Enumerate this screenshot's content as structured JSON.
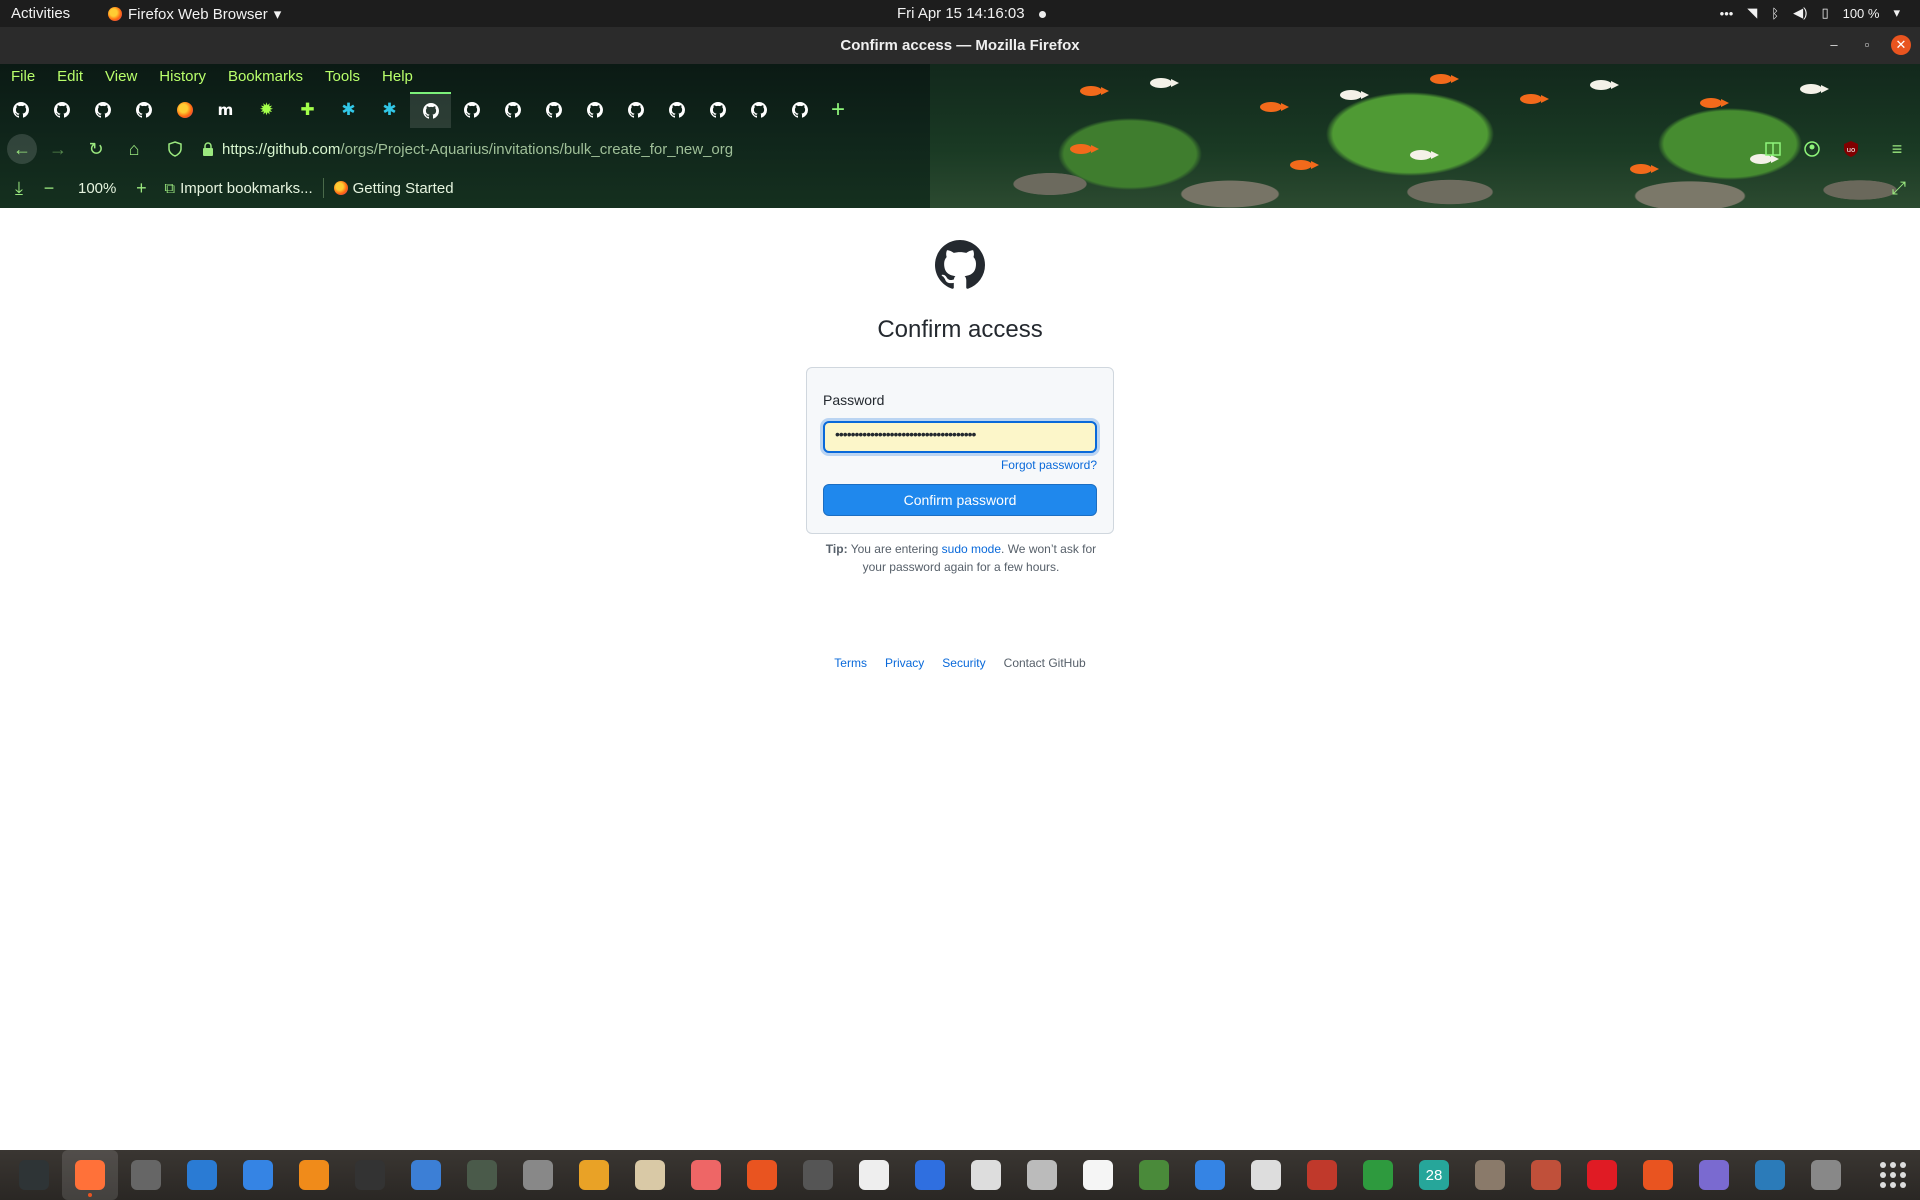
{
  "topbar": {
    "activities": "Activities",
    "app_name": "Firefox Web Browser",
    "clock": "Fri Apr 15  14:16:03",
    "battery": "100 %"
  },
  "window": {
    "title": "Confirm access — Mozilla Firefox"
  },
  "menubar": {
    "items": [
      "File",
      "Edit",
      "View",
      "History",
      "Bookmarks",
      "Tools",
      "Help"
    ]
  },
  "tabs": [
    {
      "icon": "github-icon"
    },
    {
      "icon": "github-icon"
    },
    {
      "icon": "github-icon"
    },
    {
      "icon": "github-icon"
    },
    {
      "icon": "firefox-icon"
    },
    {
      "icon": "m-icon",
      "text": "m"
    },
    {
      "icon": "settings-gear-icon"
    },
    {
      "icon": "puzzle-icon"
    },
    {
      "icon": "snowflake-icon"
    },
    {
      "icon": "snowflake-icon"
    },
    {
      "icon": "github-icon",
      "active": true
    },
    {
      "icon": "github-icon"
    },
    {
      "icon": "github-icon"
    },
    {
      "icon": "github-icon"
    },
    {
      "icon": "github-icon"
    },
    {
      "icon": "github-icon"
    },
    {
      "icon": "github-icon"
    },
    {
      "icon": "github-icon"
    },
    {
      "icon": "github-icon"
    },
    {
      "icon": "github-icon"
    }
  ],
  "url": {
    "host": "https://github.com",
    "path": "/orgs/Project-Aquarius/invitations/bulk_create_for_new_org"
  },
  "bookmarks_bar": {
    "zoom": "100%",
    "import": "Import bookmarks...",
    "getting_started": "Getting Started"
  },
  "page": {
    "title": "Confirm access",
    "password_label": "Password",
    "password_value": "••••••••••••••••••••••••••••••••••••",
    "forgot": "Forgot password?",
    "confirm_button": "Confirm password",
    "tip_label": "Tip:",
    "tip_before": " You are entering ",
    "tip_link": "sudo mode",
    "tip_after": ". We won’t ask for your password again for a few hours.",
    "footer": [
      "Terms",
      "Privacy",
      "Security"
    ],
    "footer_contact": "Contact GitHub"
  },
  "colors": {
    "accent": "#0969da",
    "button": "#1f88ed",
    "theme_text": "#b9ff6b"
  },
  "dock": [
    {
      "icon": "system-monitor-icon",
      "color": "#2e3436"
    },
    {
      "icon": "firefox-icon",
      "color": "#ff7139",
      "active": true
    },
    {
      "icon": "settings-icon",
      "color": "#666"
    },
    {
      "icon": "writer-icon",
      "color": "#2a7bd4"
    },
    {
      "icon": "help-icon",
      "color": "#3584e4"
    },
    {
      "icon": "vlc-icon",
      "color": "#f08b1a"
    },
    {
      "icon": "terminal-icon",
      "color": "#333"
    },
    {
      "icon": "text-editor-icon",
      "color": "#3c7fd6"
    },
    {
      "icon": "screenshot-icon",
      "color": "#4a5a4a"
    },
    {
      "icon": "image-viewer-icon",
      "color": "#888"
    },
    {
      "icon": "calculator-icon",
      "color": "#e9a226"
    },
    {
      "icon": "files-icon",
      "color": "#d9c9a6"
    },
    {
      "icon": "waveform-icon",
      "color": "#e66"
    },
    {
      "icon": "software-center-icon",
      "color": "#e95420"
    },
    {
      "icon": "disk-icon",
      "color": "#555"
    },
    {
      "icon": "inkscape-icon",
      "color": "#eee"
    },
    {
      "icon": "tasks-icon",
      "color": "#2f6fe0"
    },
    {
      "icon": "document-scanner-icon",
      "color": "#ddd"
    },
    {
      "icon": "archive-icon",
      "color": "#bbb"
    },
    {
      "icon": "character-map-icon",
      "color": "#f5f5f5"
    },
    {
      "icon": "vim-icon",
      "color": "#4a8a3a"
    },
    {
      "icon": "screen-recorder-icon",
      "color": "#3584e4"
    },
    {
      "icon": "music-icon",
      "color": "#ddd"
    },
    {
      "icon": "pdf-icon",
      "color": "#c0392b"
    },
    {
      "icon": "spreadsheet-icon",
      "color": "#2e9a3e"
    },
    {
      "icon": "calendar-icon",
      "color": "#26a69a",
      "text": "28"
    },
    {
      "icon": "gimp-icon",
      "color": "#8a7a6a"
    },
    {
      "icon": "game-icon",
      "color": "#c0503a"
    },
    {
      "icon": "alert-icon",
      "color": "#e01b24"
    },
    {
      "icon": "update-icon",
      "color": "#e95420"
    },
    {
      "icon": "camera-icon",
      "color": "#7a6ad0"
    },
    {
      "icon": "remote-desktop-icon",
      "color": "#2b7bb9"
    },
    {
      "icon": "app-center-icon",
      "color": "#888"
    }
  ]
}
